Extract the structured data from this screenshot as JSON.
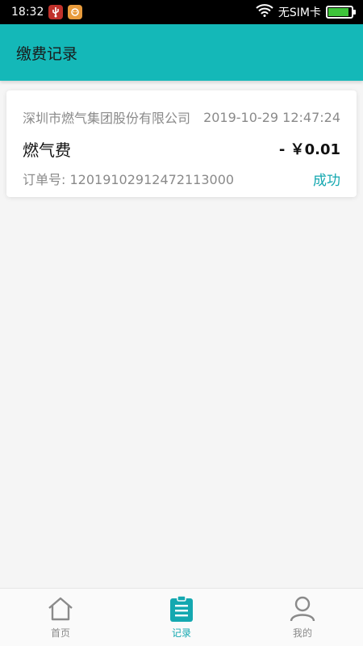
{
  "status_bar": {
    "time": "18:32",
    "carrier": "无SIM卡",
    "battery_level": 0.9
  },
  "app_bar": {
    "title": "缴费记录"
  },
  "records": [
    {
      "company": "深圳市燃气集团股份有限公司",
      "datetime": "2019-10-29 12:47:24",
      "fee_type": "燃气费",
      "amount": "- ￥0.01",
      "order": "订单号: 1201910291247211300​0",
      "status": "成功"
    }
  ],
  "tabs": [
    {
      "label": "首页",
      "icon": "home-icon",
      "active": false
    },
    {
      "label": "记录",
      "icon": "clipboard-icon",
      "active": true
    },
    {
      "label": "我的",
      "icon": "user-icon",
      "active": false
    }
  ],
  "colors": {
    "accent": "#14b8b8",
    "status_success": "#14a8b0"
  }
}
